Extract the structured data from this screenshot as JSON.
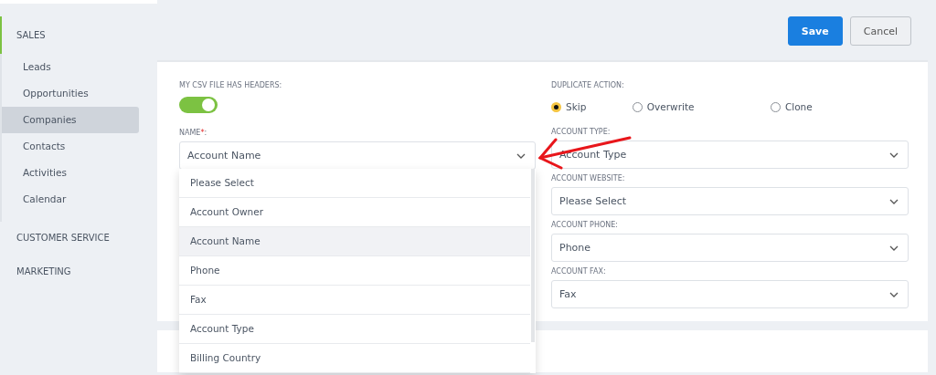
{
  "sidebar": {
    "sections": [
      {
        "label": "SALES",
        "active": true,
        "items": [
          {
            "label": "Leads",
            "selected": false
          },
          {
            "label": "Opportunities",
            "selected": false
          },
          {
            "label": "Companies",
            "selected": true
          },
          {
            "label": "Contacts",
            "selected": false
          },
          {
            "label": "Activities",
            "selected": false
          },
          {
            "label": "Calendar",
            "selected": false
          }
        ]
      },
      {
        "label": "CUSTOMER SERVICE",
        "active": false
      },
      {
        "label": "MARKETING",
        "active": false
      }
    ]
  },
  "toolbar": {
    "buttons": [
      {
        "label": "Save",
        "kind": "primary"
      },
      {
        "label": "Cancel",
        "kind": "secondary"
      }
    ]
  },
  "form": {
    "csv_headers": {
      "label": "MY CSV FILE HAS HEADERS:",
      "on": true
    },
    "name": {
      "label": "NAME",
      "required_mark": "*",
      "label_end": ":",
      "value": "Account Name",
      "expanded": true,
      "options": [
        {
          "label": "Please Select",
          "selected": false
        },
        {
          "label": "Account Owner",
          "selected": false
        },
        {
          "label": "Account Name",
          "selected": true
        },
        {
          "label": "Phone",
          "selected": false
        },
        {
          "label": "Fax",
          "selected": false
        },
        {
          "label": "Account Type",
          "selected": false
        },
        {
          "label": "Billing Country",
          "selected": false
        }
      ]
    },
    "duplicate_action": {
      "label": "DUPLICATE ACTION:",
      "options": [
        {
          "label": "Skip",
          "selected": true
        },
        {
          "label": "Overwrite",
          "selected": false
        },
        {
          "label": "Clone",
          "selected": false
        }
      ]
    },
    "mappings": [
      {
        "label": "ACCOUNT TYPE:",
        "value": "Account Type"
      },
      {
        "label": "ACCOUNT WEBSITE:",
        "value": "Please Select"
      },
      {
        "label": "ACCOUNT PHONE:",
        "value": "Phone"
      },
      {
        "label": "ACCOUNT FAX:",
        "value": "Fax"
      }
    ]
  }
}
